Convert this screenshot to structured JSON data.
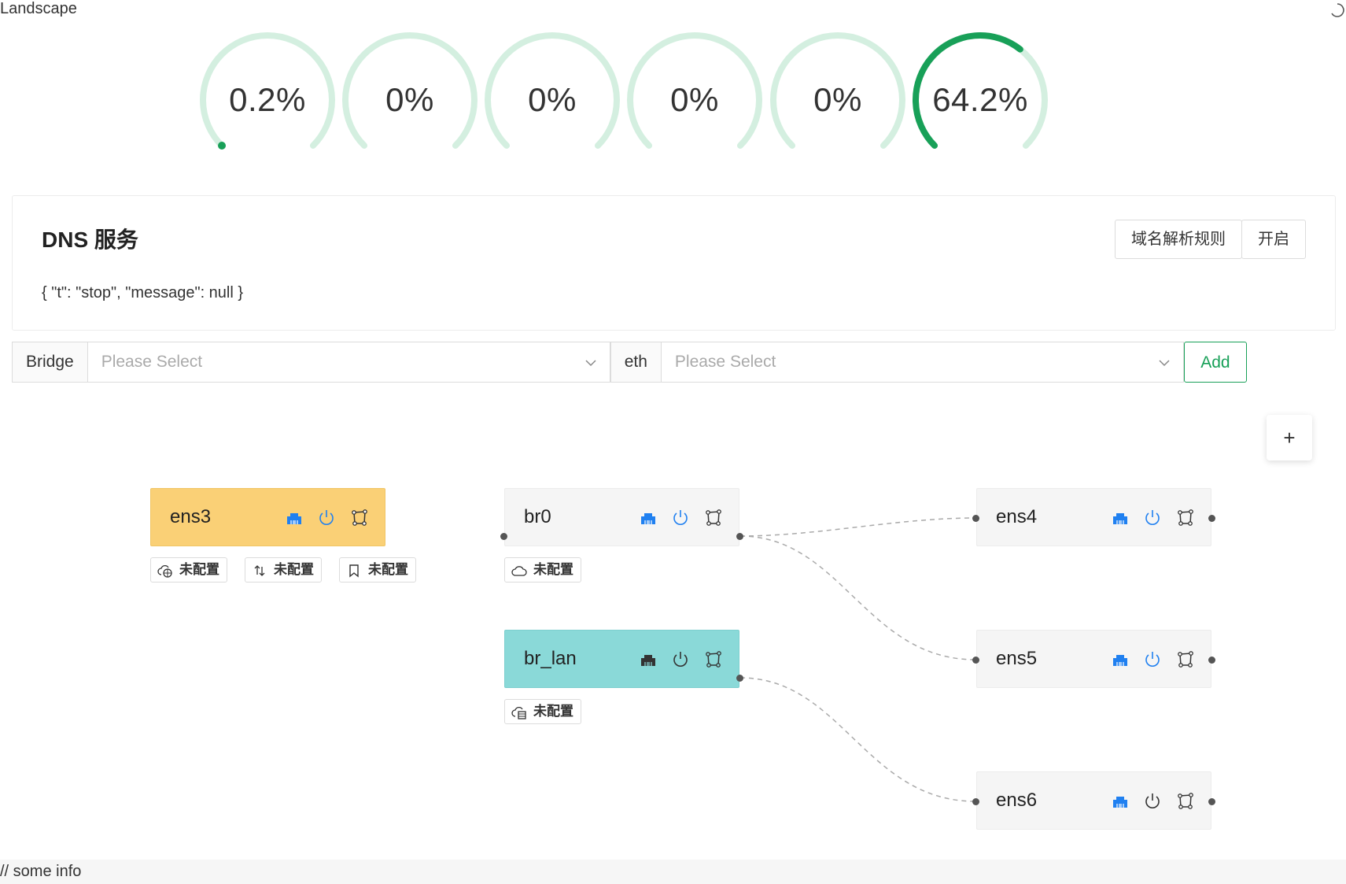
{
  "app": {
    "title": "Landscape"
  },
  "gauges": [
    {
      "label": "0.2%",
      "percent": 0.2
    },
    {
      "label": "0%",
      "percent": 0
    },
    {
      "label": "0%",
      "percent": 0
    },
    {
      "label": "0%",
      "percent": 0
    },
    {
      "label": "0%",
      "percent": 0
    },
    {
      "label": "64.2%",
      "percent": 64.2
    }
  ],
  "colors": {
    "accent": "#18a058",
    "track": "#d4efe0",
    "blue_icon": "#2080f0",
    "node_yellow": "#fad076",
    "node_teal": "#8ad9d8"
  },
  "dns": {
    "title": "DNS 服务",
    "message": "{ \"t\": \"stop\", \"message\": null }",
    "rules_button": "域名解析规则",
    "enable_button": "开启"
  },
  "select_bar": {
    "bridge_label": "Bridge",
    "bridge_placeholder": "Please Select",
    "eth_label": "eth",
    "eth_placeholder": "Please Select",
    "add_button": "Add"
  },
  "canvas": {
    "zoom_button": "+"
  },
  "nodes": {
    "ens3": {
      "name": "ens3",
      "network_icon": "ethernet-port-icon"
    },
    "br0": {
      "name": "br0",
      "network_icon": "ethernet-port-icon"
    },
    "br_lan": {
      "name": "br_lan",
      "network_icon": "ethernet-port-icon"
    },
    "ens4": {
      "name": "ens4",
      "network_icon": "ethernet-port-icon"
    },
    "ens5": {
      "name": "ens5",
      "network_icon": "ethernet-port-icon"
    },
    "ens6": {
      "name": "ens6",
      "network_icon": "ethernet-port-icon"
    }
  },
  "tags": {
    "ens3_wan": {
      "label": "未配置",
      "icon": "cloud-globe-icon"
    },
    "ens3_transfer": {
      "label": "未配置",
      "icon": "updown-arrows-icon"
    },
    "ens3_mark": {
      "label": "未配置",
      "icon": "bookmark-icon"
    },
    "br0_cloud": {
      "label": "未配置",
      "icon": "cloud-icon"
    },
    "br_lan_dhcp": {
      "label": "未配置",
      "icon": "cloud-server-icon"
    }
  },
  "footer": {
    "text": "// some info"
  }
}
